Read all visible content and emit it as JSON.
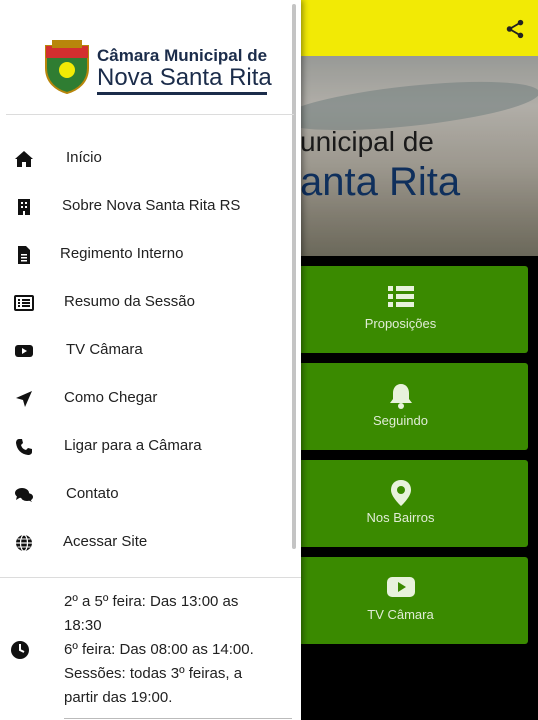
{
  "appbar": {
    "accent": "#f2ea05",
    "share_icon": "share-icon"
  },
  "hero": {
    "line1": "unicipal de",
    "line2": "anta Rita"
  },
  "tiles": [
    {
      "label": "Proposições",
      "icon": "list-icon"
    },
    {
      "label": "Seguindo",
      "icon": "bell-icon"
    },
    {
      "label": "Nos Bairros",
      "icon": "map-marker-icon"
    },
    {
      "label": "TV Câmara",
      "icon": "youtube-icon"
    }
  ],
  "drawer": {
    "logo": {
      "line1": "Câmara Municipal de",
      "line2": "Nova Santa Rita"
    },
    "items": [
      {
        "label": "Início",
        "icon": "home-icon"
      },
      {
        "label": "Sobre Nova Santa Rita RS",
        "icon": "building-icon"
      },
      {
        "label": "Regimento Interno",
        "icon": "document-icon"
      },
      {
        "label": "Resumo da Sessão",
        "icon": "list-alt-icon"
      },
      {
        "label": "TV Câmara",
        "icon": "youtube-icon"
      },
      {
        "label": "Como Chegar",
        "icon": "location-arrow-icon"
      },
      {
        "label": "Ligar para a Câmara",
        "icon": "phone-icon"
      },
      {
        "label": "Contato",
        "icon": "comments-icon"
      },
      {
        "label": "Acessar Site",
        "icon": "globe-icon"
      }
    ],
    "hours": {
      "line1": "2º a 5º feira: Das 13:00 as 18:30",
      "line2": "6º feira: Das 08:00 as 14:00.",
      "line3": "Sessões: todas 3º feiras, a partir das 19:00."
    }
  },
  "colors": {
    "tile_green": "#3a8a00",
    "text_dark": "#212121"
  }
}
